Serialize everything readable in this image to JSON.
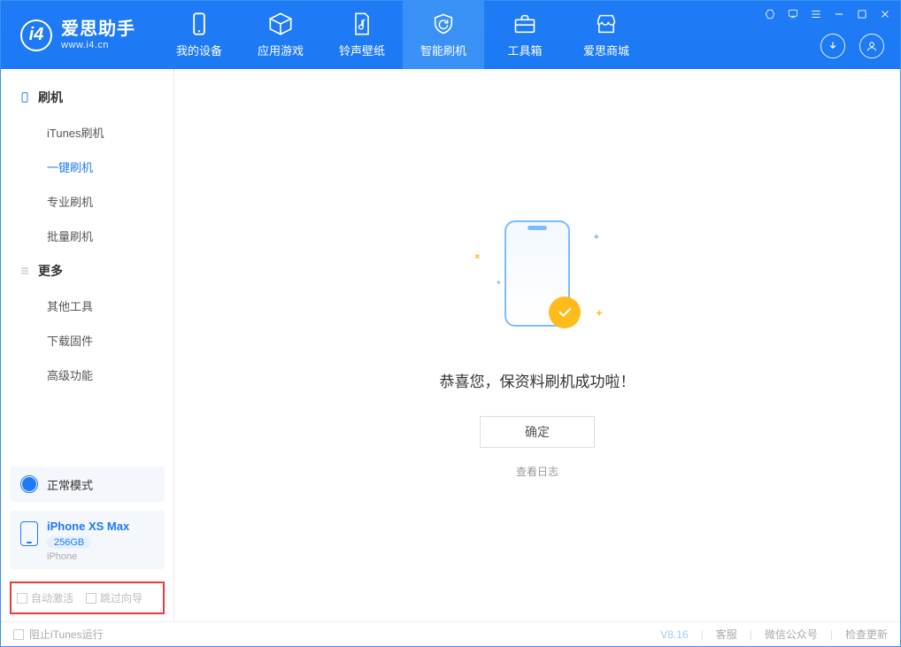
{
  "brand": {
    "title": "爱思助手",
    "sub": "www.i4.cn",
    "logo_glyph": "i4"
  },
  "header_tabs": {
    "device": "我的设备",
    "apps": "应用游戏",
    "ringtone": "铃声壁纸",
    "flash": "智能刷机",
    "toolbox": "工具箱",
    "store": "爱思商城"
  },
  "sidebar": {
    "group_flash": "刷机",
    "group_more": "更多",
    "items": {
      "itunes": "iTunes刷机",
      "oneclick": "一键刷机",
      "pro": "专业刷机",
      "batch": "批量刷机",
      "other_tools": "其他工具",
      "download_fw": "下载固件",
      "advanced": "高级功能"
    }
  },
  "mode_card": {
    "label": "正常模式"
  },
  "device_card": {
    "name": "iPhone XS Max",
    "capacity": "256GB",
    "type": "iPhone"
  },
  "checks": {
    "auto_activate": "自动激活",
    "skip_guide": "跳过向导"
  },
  "main": {
    "message": "恭喜您，保资料刷机成功啦！",
    "ok": "确定",
    "view_log": "查看日志"
  },
  "footer": {
    "stop_itunes": "阻止iTunes运行",
    "version": "V8.16",
    "support": "客服",
    "wechat": "微信公众号",
    "update": "检查更新"
  }
}
